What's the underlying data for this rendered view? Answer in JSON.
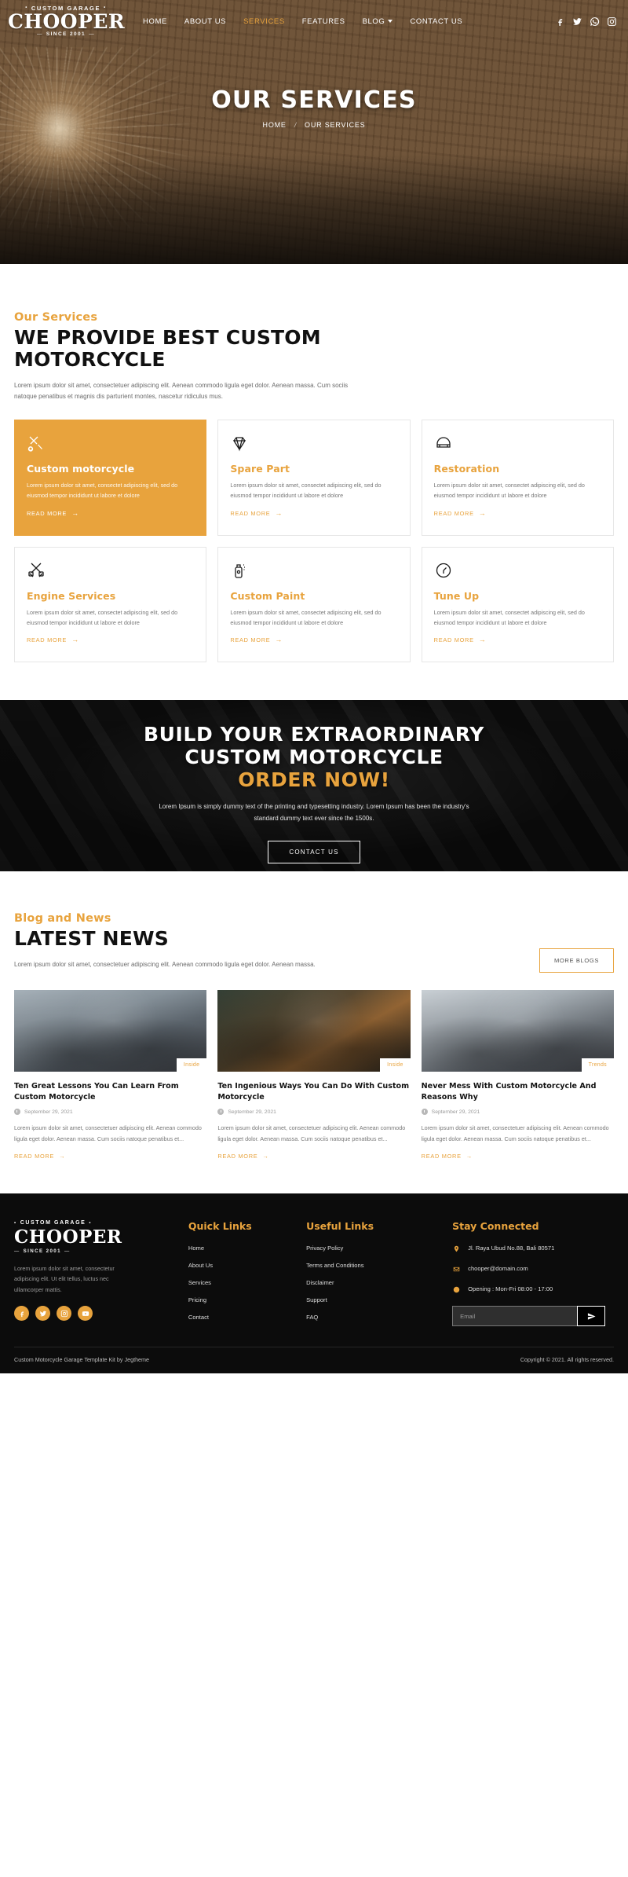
{
  "brand": {
    "top": "CUSTOM GARAGE",
    "name": "CHOOPER",
    "bottom": "SINCE 2001"
  },
  "nav": {
    "items": [
      {
        "label": "HOME",
        "active": false
      },
      {
        "label": "ABOUT US",
        "active": false
      },
      {
        "label": "SERVICES",
        "active": true
      },
      {
        "label": "FEATURES",
        "active": false
      },
      {
        "label": "BLOG",
        "active": false,
        "caret": true
      },
      {
        "label": "CONTACT US",
        "active": false
      }
    ],
    "social": [
      "facebook-icon",
      "twitter-icon",
      "whatsapp-icon",
      "instagram-icon"
    ]
  },
  "hero": {
    "title": "OUR SERVICES",
    "breadcrumb_home": "HOME",
    "breadcrumb_sep": "/",
    "breadcrumb_current": "OUR SERVICES"
  },
  "services": {
    "eyebrow": "Our Services",
    "title": "WE PROVIDE BEST CUSTOM MOTORCYCLE",
    "description": "Lorem ipsum dolor sit amet, consectetuer adipiscing elit. Aenean commodo ligula eget dolor. Aenean massa. Cum sociis natoque penatibus et magnis dis parturient montes, nascetur ridiculus mus.",
    "read_more": "READ MORE",
    "items": [
      {
        "title": "Custom motorcycle",
        "icon": "wrench-screwdriver-icon",
        "text": "Lorem ipsum dolor sit amet, consectet adipiscing elit, sed do eiusmod tempor incididunt ut labore et dolore",
        "active": true
      },
      {
        "title": "Spare Part",
        "icon": "diamond-icon",
        "text": "Lorem ipsum dolor sit amet, consectet adipiscing elit, sed do eiusmod tempor incididunt ut labore et dolore",
        "active": false
      },
      {
        "title": "Restoration",
        "icon": "helmet-icon",
        "text": "Lorem ipsum dolor sit amet, consectet adipiscing elit, sed do eiusmod tempor incididunt ut labore et dolore",
        "active": false
      },
      {
        "title": "Engine Services",
        "icon": "pistons-icon",
        "text": "Lorem ipsum dolor sit amet, consectet adipiscing elit, sed do eiusmod tempor incididunt ut labore et dolore",
        "active": false
      },
      {
        "title": "Custom Paint",
        "icon": "spray-can-icon",
        "text": "Lorem ipsum dolor sit amet, consectet adipiscing elit, sed do eiusmod tempor incididunt ut labore et dolore",
        "active": false
      },
      {
        "title": "Tune Up",
        "icon": "speedometer-icon",
        "text": "Lorem ipsum dolor sit amet, consectet adipiscing elit, sed do eiusmod tempor incididunt ut labore et dolore",
        "active": false
      }
    ]
  },
  "cta": {
    "line1": "BUILD YOUR EXTRAORDINARY",
    "line2": "CUSTOM MOTORCYCLE",
    "line3": "ORDER NOW!",
    "text": "Lorem Ipsum is simply dummy text of the printing and typesetting industry. Lorem Ipsum has been the industry's standard dummy text ever since the 1500s.",
    "button": "CONTACT US"
  },
  "news": {
    "eyebrow": "Blog and News",
    "title": "LATEST NEWS",
    "description": "Lorem ipsum dolor sit amet, consectetuer adipiscing elit. Aenean commodo ligula eget dolor. Aenean massa.",
    "more_button": "MORE BLOGS",
    "read_more": "READ MORE",
    "posts": [
      {
        "tag": "Inside",
        "title": "Ten Great Lessons You Can Learn From Custom Motorcycle",
        "date": "September 29, 2021",
        "text": "Lorem ipsum dolor sit amet, consectetuer adipiscing elit. Aenean commodo ligula eget dolor. Aenean massa. Cum sociis natoque penatibus et...",
        "thumb": "thumb-a"
      },
      {
        "tag": "Inside",
        "title": "Ten Ingenious Ways You Can Do With Custom Motorcycle",
        "date": "September 29, 2021",
        "text": "Lorem ipsum dolor sit amet, consectetuer adipiscing elit. Aenean commodo ligula eget dolor. Aenean massa. Cum sociis natoque penatibus et...",
        "thumb": "thumb-b"
      },
      {
        "tag": "Trends",
        "title": "Never Mess With Custom Motorcycle And Reasons Why",
        "date": "September 29, 2021",
        "text": "Lorem ipsum dolor sit amet, consectetuer adipiscing elit. Aenean commodo ligula eget dolor. Aenean massa. Cum sociis natoque penatibus et...",
        "thumb": "thumb-c"
      }
    ]
  },
  "footer": {
    "about": "Lorem ipsum dolor sit amet, consectetur adipiscing elit. Ut elit tellus, luctus nec ullamcorper mattis.",
    "social": [
      "facebook-icon",
      "twitter-icon",
      "instagram-icon",
      "youtube-icon"
    ],
    "quick_links": {
      "title": "Quick Links",
      "items": [
        "Home",
        "About Us",
        "Services",
        "Pricing",
        "Contact"
      ]
    },
    "useful_links": {
      "title": "Useful Links",
      "items": [
        "Privacy Policy",
        "Terms and Conditions",
        "Disclaimer",
        "Support",
        "FAQ"
      ]
    },
    "stay_connected": {
      "title": "Stay Connected",
      "address": "Jl. Raya Ubud No.88, Bali 80571",
      "email": "chooper@domain.com",
      "hours": "Opening : Mon-Fri 08:00 - 17:00",
      "email_placeholder": "Email"
    },
    "bottom_left": "Custom Motorcycle Garage Template Kit by Jegtheme",
    "bottom_right": "Copyright © 2021. All rights reserved."
  },
  "colors": {
    "accent": "#e8a33d",
    "dark": "#0c0c0c"
  }
}
